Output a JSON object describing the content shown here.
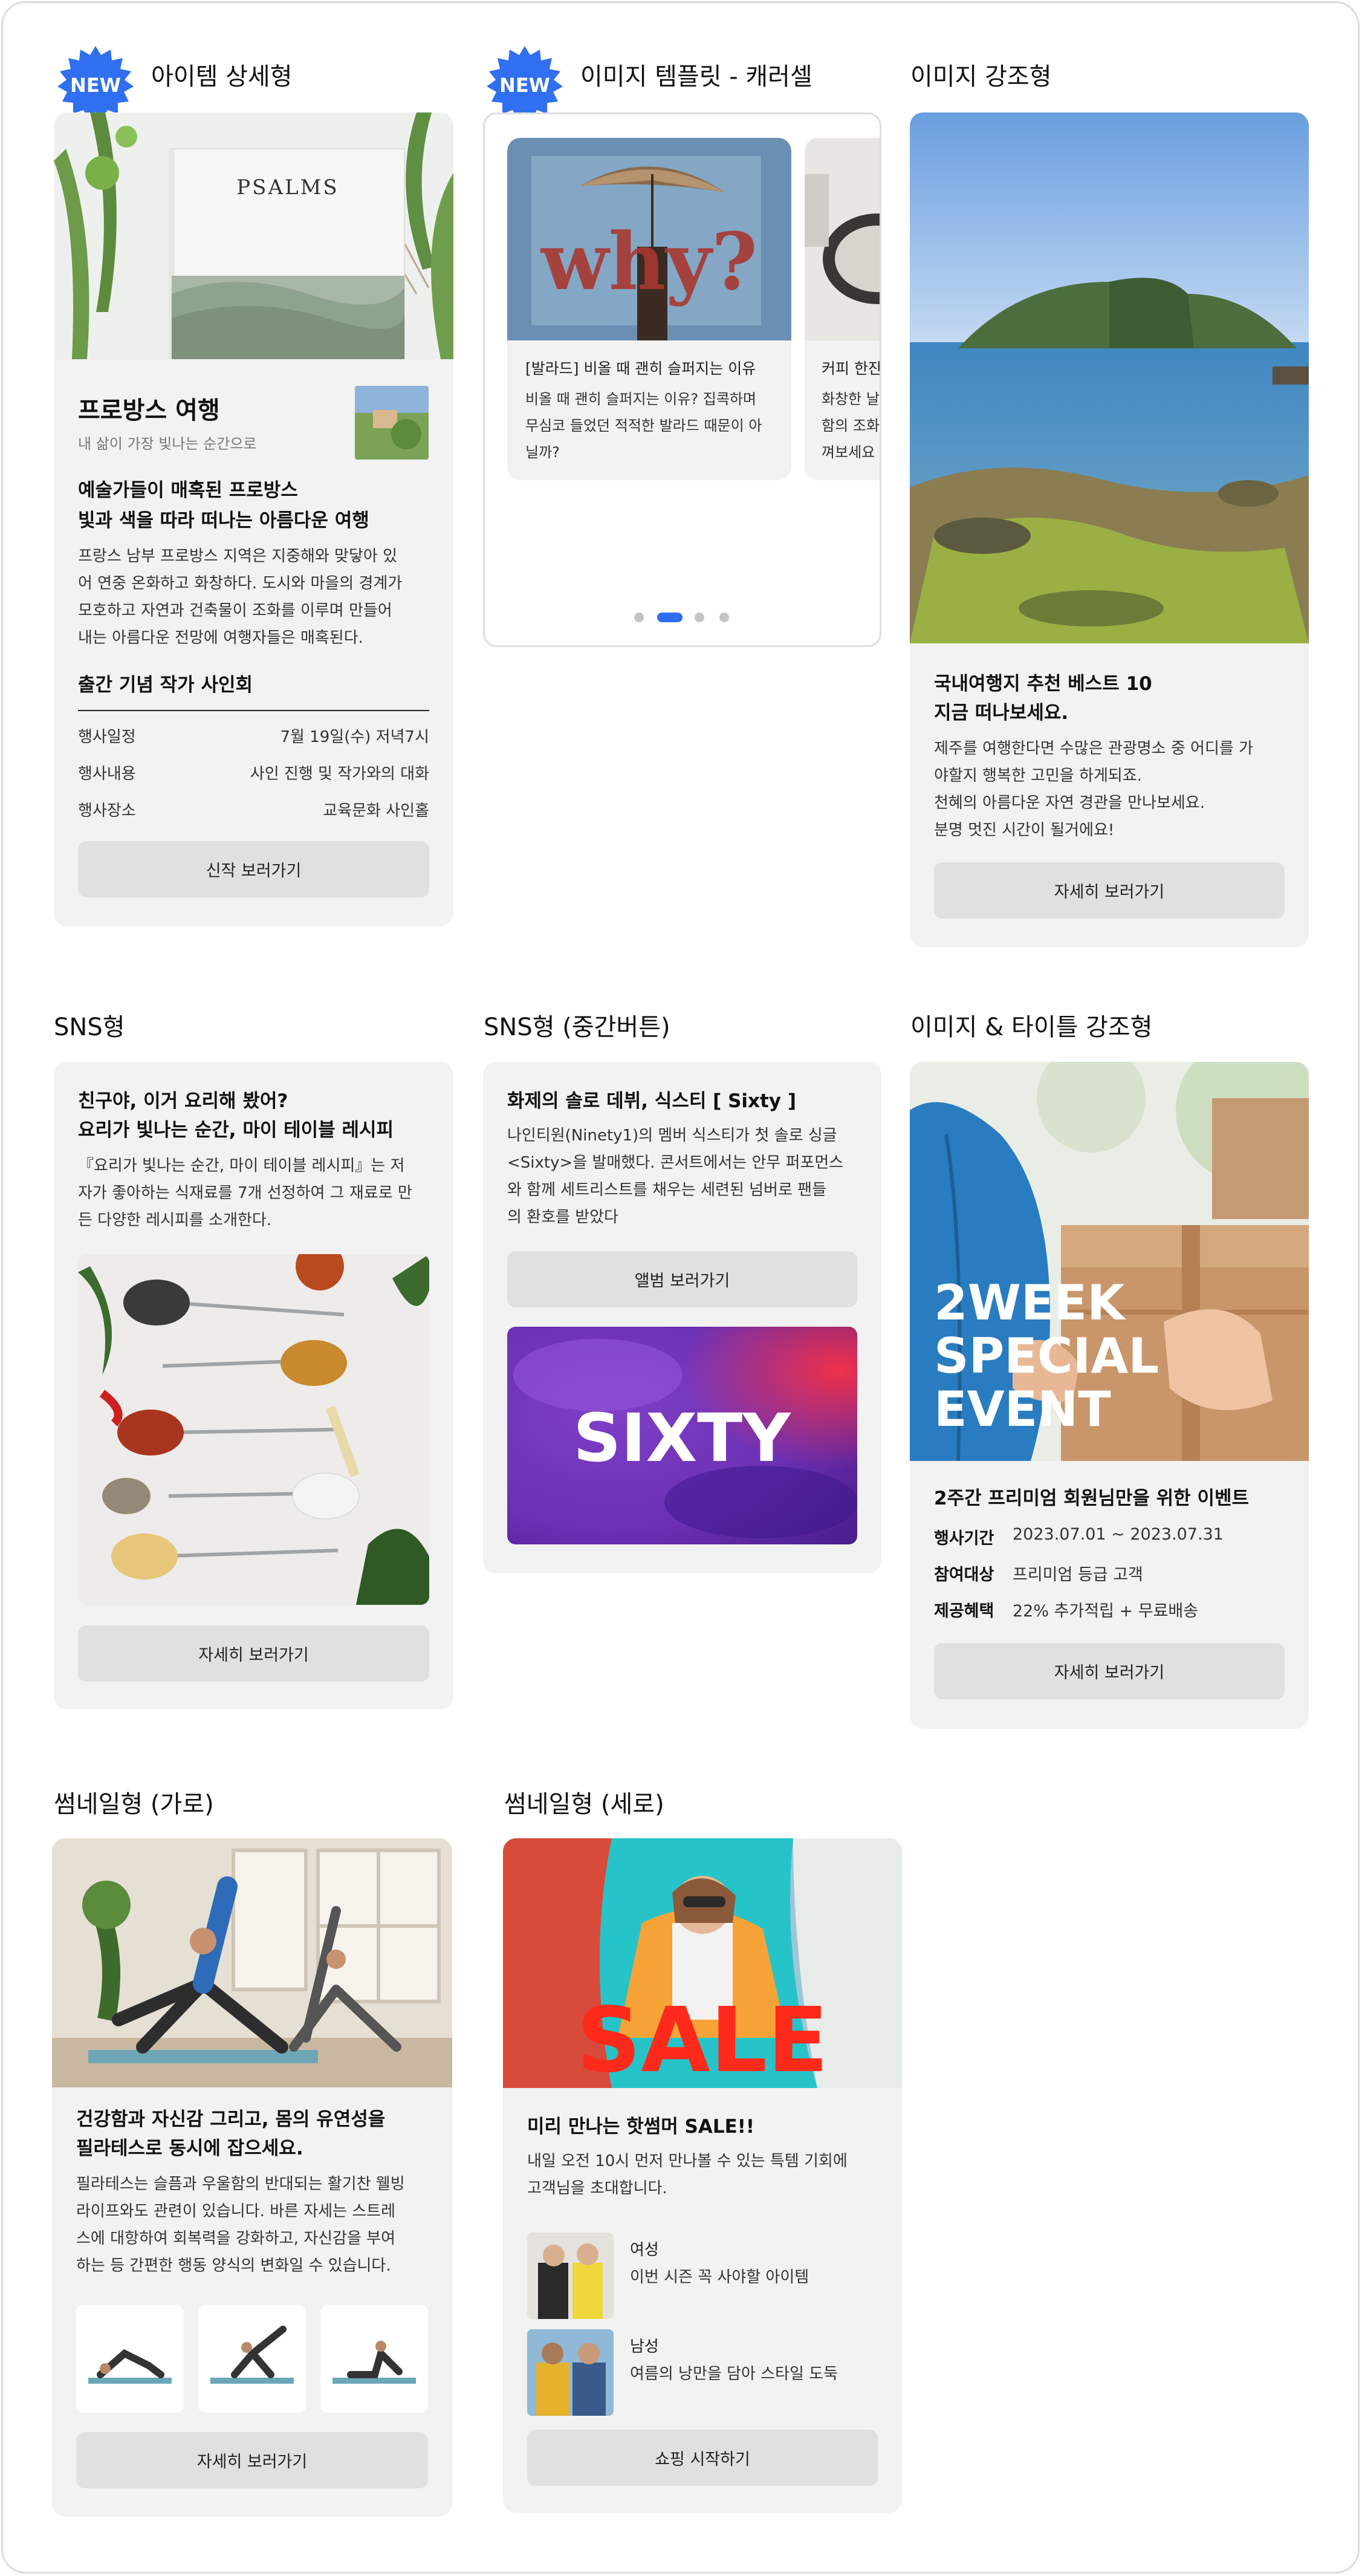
{
  "sections": {
    "item_detail": {
      "title": "아이템 상세형",
      "badge": "NEW",
      "cover_word": "PSALMS",
      "heading": "프로방스 여행",
      "subheading": "내 삶이 가장 빛나는 순간으로",
      "headline_1": "예술가들이 매혹된 프로방스",
      "headline_2": "빛과 색을 따라 떠나는 아름다운 여행",
      "body": [
        "프랑스 남부 프로방스 지역은 지중해와 맞닿아 있",
        "어 연중 온화하고 화창하다. 도시와 마을의 경계가",
        "모호하고 자연과 건축물이 조화를 이루며 만들어",
        "내는 아름다운 전망에 여행자들은 매혹된다."
      ],
      "event_title": "출간 기념 작가 사인회",
      "rows": [
        {
          "label": "행사일정",
          "value": "7월 19일(수) 저녁7시"
        },
        {
          "label": "행사내용",
          "value": "사인 진행 및 작가와의 대화"
        },
        {
          "label": "행사장소",
          "value": "교육문화 사인홀"
        }
      ],
      "button": "신작 보러가기"
    },
    "carousel": {
      "title": "이미지 템플릿 - 캐러셀",
      "badge": "NEW",
      "image_word": "why?",
      "slide1_title": "[발라드] 비올 때 괜히 슬퍼지는 이유",
      "slide1_body": [
        "비올 때 괜히 슬퍼지는 이유? 집콕하며",
        "무심코 들었던 적적한 발라드 때문이 아",
        "닐까?"
      ],
      "slide2_title": "커피 한잔",
      "slide2_body": [
        "화창한 날",
        "함의 조화",
        "껴보세요"
      ]
    },
    "image_emphasis": {
      "title": "이미지 강조형",
      "headline_1": "국내여행지 추천 베스트 10",
      "headline_2": "지금 떠나보세요.",
      "body": [
        "제주를 여행한다면 수많은 관광명소 중 어디를 가",
        "야할지 행복한 고민을 하게되죠.",
        "천혜의 아름다운 자연 경관을 만나보세요.",
        "분명 멋진 시간이 될거에요!"
      ],
      "button": "자세히 보러가기"
    },
    "sns": {
      "title": "SNS형",
      "headline_1": "친구야, 이거 요리해 봤어?",
      "headline_2": "요리가 빛나는 순간, 마이 테이블 레시피",
      "body": [
        "『요리가 빛나는 순간, 마이 테이블 레시피』는 저",
        "자가 좋아하는 식재료를 7개 선정하여 그 재료로 만",
        "든 다양한 레시피를 소개한다."
      ],
      "button": "자세히 보러가기"
    },
    "sns_mid": {
      "title": "SNS형 (중간버튼)",
      "headline": "화제의 솔로 데뷔, 식스티 [ Sixty ]",
      "body": [
        "나인티원(Ninety1)의 멤버 식스티가 첫 솔로 싱글",
        "<Sixty>을 발매했다. 콘서트에서는 안무 퍼포먼스",
        "와 함께 세트리스트를 채우는 세련된 넘버로 팬들",
        "의 환호를 받았다"
      ],
      "button": "앨범 보러가기",
      "album_word": "SIXTY"
    },
    "image_title": {
      "title": "이미지 & 타이틀 강조형",
      "overlay": [
        "2WEEK",
        "SPECIAL",
        "EVENT"
      ],
      "headline": "2주간 프리미엄 회원님만을 위한 이벤트",
      "rows": [
        {
          "label": "행사기간",
          "value": "2023.07.01 ~ 2023.07.31"
        },
        {
          "label": "참여대상",
          "value": "프리미엄 등급 고객"
        },
        {
          "label": "제공혜택",
          "value": "22% 추가적립 + 무료배송"
        }
      ],
      "button": "자세히 보러가기"
    },
    "thumb_h": {
      "title": "썸네일형 (가로)",
      "headline_1": "건강함과 자신감 그리고, 몸의 유연성을",
      "headline_2": "필라테스로 동시에 잡으세요.",
      "body": [
        "필라테스는 슬픔과 우울함의 반대되는 활기찬 웰빙",
        "라이프와도 관련이 있습니다. 바른 자세는 스트레",
        "스에 대항하여 회복력을 강화하고, 자신감을 부여",
        "하는 등 간편한 행동 양식의 변화일 수 있습니다."
      ],
      "button": "자세히 보러가기"
    },
    "thumb_v": {
      "title": "썸네일형 (세로)",
      "image_word": "SALE",
      "headline": "미리 만나는 핫썸머 SALE!!",
      "body": [
        "내일 오전 10시 먼저 만나볼 수 있는 특템 기회에",
        "고객님을 초대합니다."
      ],
      "items": [
        {
          "label": "여성",
          "desc": "이번 시즌 꼭 사야할 아이템"
        },
        {
          "label": "남성",
          "desc": "여름의 낭만을 담아 스타일 도둑"
        }
      ],
      "button": "쇼핑 시작하기"
    }
  },
  "colors": {
    "badge_blue": "#2f6ff0",
    "card_bg": "#f2f2f2",
    "button_bg": "#e0e0e0",
    "dot_active": "#2d6ff0"
  }
}
